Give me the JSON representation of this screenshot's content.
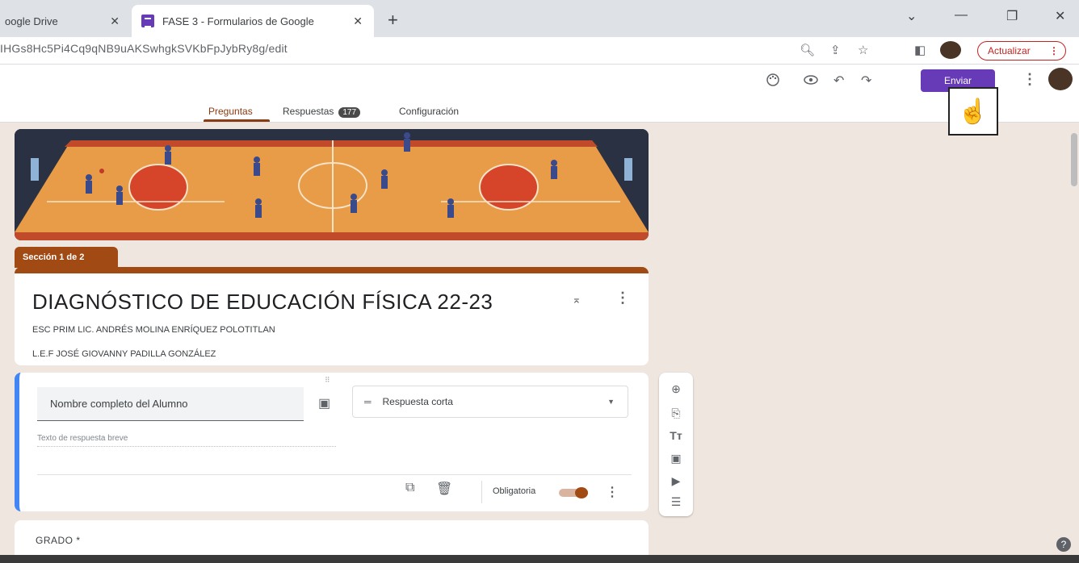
{
  "browser": {
    "tabs": [
      {
        "label": "oogle Drive",
        "close": "✕"
      },
      {
        "label": "FASE 3 - Formularios de Google",
        "close": "✕"
      }
    ],
    "new_tab": "+",
    "url": "IHGs8Hc5Pi4Cq9qNB9uAKSwhgkSVKbFpJybRy8g/edit",
    "update_button": "Actualizar",
    "update_menu": "⋮"
  },
  "form_header": {
    "send_button": "Enviar",
    "tabs": {
      "questions": "Preguntas",
      "responses": "Respuestas",
      "responses_count": "177",
      "settings": "Configuración"
    }
  },
  "section": {
    "label": "Sección 1 de 2",
    "title": "DIAGNÓSTICO DE EDUCACIÓN FÍSICA 22-23",
    "description_lines": [
      "ESC PRIM LIC. ANDRÉS MOLINA ENRÍQUEZ POLOTITLAN",
      "L.E.F JOSÉ GIOVANNY PADILLA GONZÁLEZ"
    ]
  },
  "question": {
    "title": "Nombre completo del Alumno",
    "type": "Respuesta corta",
    "answer_placeholder": "Texto de respuesta breve",
    "required_label": "Obligatoria",
    "required": true
  },
  "next_question": {
    "title": "GRADO *"
  },
  "icons": {
    "palette": "palette-icon",
    "preview": "eye-icon",
    "undo": "undo-icon",
    "redo": "redo-icon"
  },
  "colors": {
    "accent": "#673ab7",
    "theme": "#a14a13",
    "question_active": "#4285f4",
    "background": "#efe6df"
  }
}
